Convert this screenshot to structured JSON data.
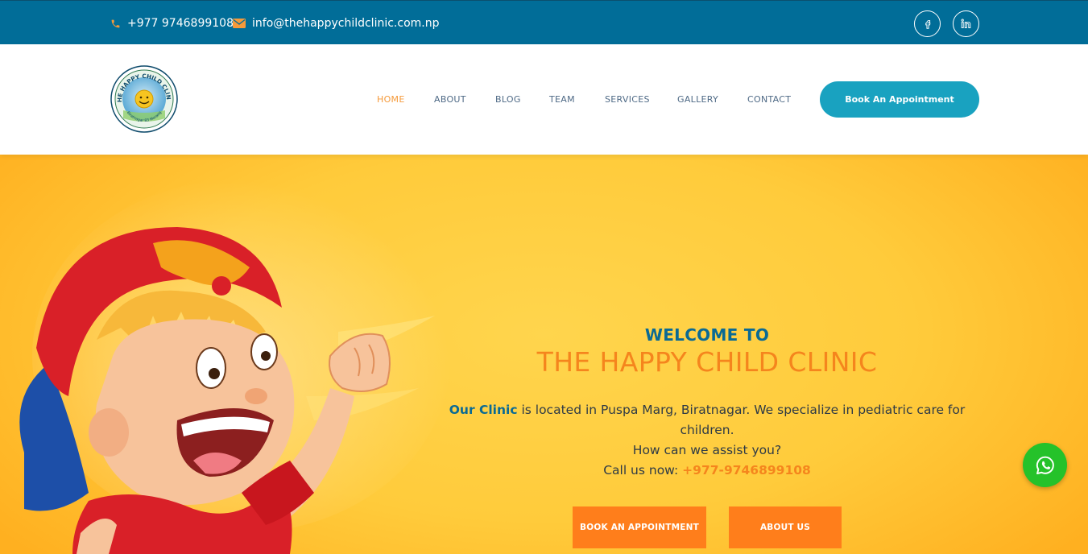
{
  "topbar": {
    "phone": "+977 9746899108",
    "email": "info@thehappychildclinic.com.np",
    "phone_icon": "phone-icon",
    "email_icon": "envelope-icon",
    "social": [
      {
        "name": "facebook",
        "icon": "facebook-icon"
      },
      {
        "name": "linkedin",
        "icon": "linkedin-icon"
      }
    ]
  },
  "header": {
    "logo_text_top": "THE HAPPY CHILD CLINIC",
    "logo_text_bottom": "Biratnagar 83 Morang",
    "nav": [
      {
        "label": "HOME",
        "active": true
      },
      {
        "label": "ABOUT",
        "active": false
      },
      {
        "label": "BLOG",
        "active": false
      },
      {
        "label": "TEAM",
        "active": false
      },
      {
        "label": "SERVICES",
        "active": false
      },
      {
        "label": "GALLERY",
        "active": false
      },
      {
        "label": "CONTACT",
        "active": false
      }
    ],
    "book_button": "Book An Appointment"
  },
  "hero": {
    "welcome": "WELCOME TO",
    "title": "THE HAPPY CHILD CLINIC",
    "desc_highlight": "Our Clinic",
    "desc_rest": " is located in Puspa Marg, Biratnagar. We specialize in pediatric care for children.",
    "desc_line2": "How can we assist you?",
    "call_label": "Call us now: ",
    "call_number": "+977-9746899108",
    "buttons": {
      "book": "BOOK AN APPOINTMENT",
      "about": "ABOUT US"
    }
  },
  "colors": {
    "topbar": "#016d98",
    "accent_orange": "#f5851d",
    "accent_blue": "#0a6a94",
    "book_button": "#19a2c0",
    "hero_yellow": "#ffcb3b",
    "whatsapp": "#25c22a"
  },
  "whatsapp_icon": "whatsapp-icon"
}
